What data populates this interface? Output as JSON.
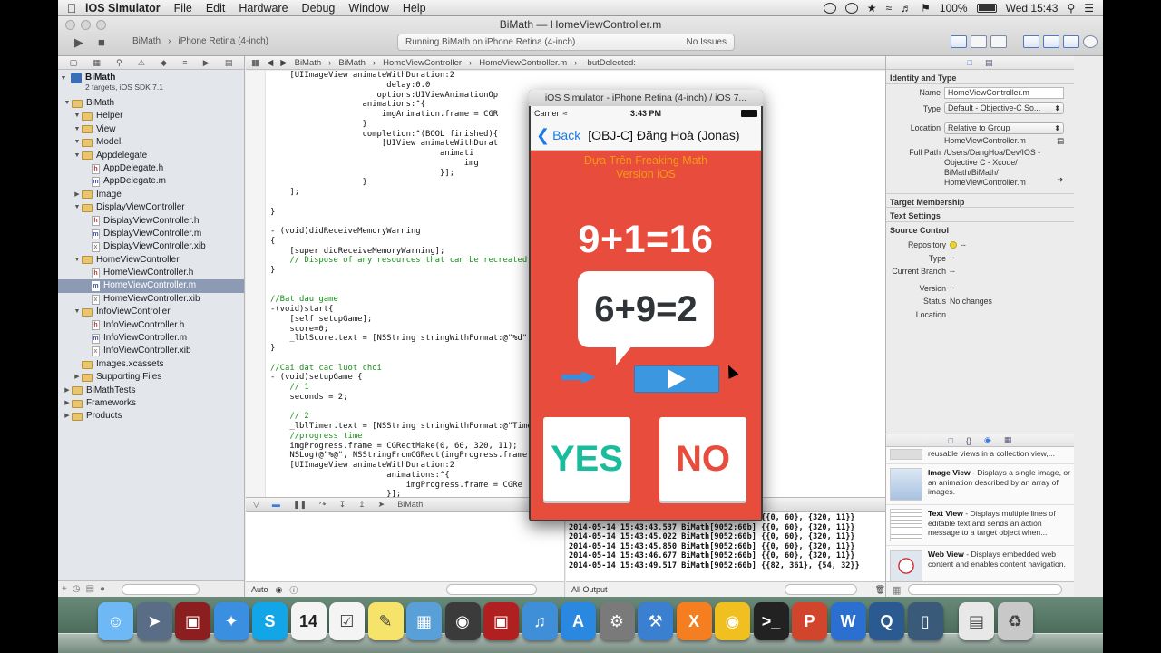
{
  "menubar": {
    "app": "iOS Simulator",
    "items": [
      "File",
      "Edit",
      "Hardware",
      "Debug",
      "Window",
      "Help"
    ],
    "battery": "100%",
    "clock": "Wed 15:43"
  },
  "xcode": {
    "window_title": "BiMath — HomeViewController.m",
    "title_project": "BiMath",
    "title_file": "HomeViewController.m",
    "scheme": "BiMath",
    "destination": "iPhone Retina (4-inch)",
    "activity": "Running BiMath on iPhone Retina (4-inch)",
    "issues": "No Issues"
  },
  "navigator": {
    "project": "BiMath",
    "project_sub": "2 targets, iOS SDK 7.1",
    "items": [
      {
        "label": "BiMath",
        "kind": "folder",
        "depth": 1,
        "open": true
      },
      {
        "label": "Helper",
        "kind": "folder",
        "depth": 2,
        "open": true
      },
      {
        "label": "View",
        "kind": "folder",
        "depth": 2,
        "open": true
      },
      {
        "label": "Model",
        "kind": "folder",
        "depth": 2,
        "open": true
      },
      {
        "label": "Appdelegate",
        "kind": "folder",
        "depth": 2,
        "open": true
      },
      {
        "label": "AppDelegate.h",
        "kind": "h",
        "depth": 3
      },
      {
        "label": "AppDelegate.m",
        "kind": "m",
        "depth": 3
      },
      {
        "label": "Image",
        "kind": "folder",
        "depth": 2,
        "open": false
      },
      {
        "label": "DisplayViewController",
        "kind": "folder",
        "depth": 2,
        "open": true
      },
      {
        "label": "DisplayViewController.h",
        "kind": "h",
        "depth": 3
      },
      {
        "label": "DisplayViewController.m",
        "kind": "m",
        "depth": 3
      },
      {
        "label": "DisplayViewController.xib",
        "kind": "x",
        "depth": 3
      },
      {
        "label": "HomeViewController",
        "kind": "folder",
        "depth": 2,
        "open": true
      },
      {
        "label": "HomeViewController.h",
        "kind": "h",
        "depth": 3
      },
      {
        "label": "HomeViewController.m",
        "kind": "m",
        "depth": 3,
        "selected": true
      },
      {
        "label": "HomeViewController.xib",
        "kind": "x",
        "depth": 3
      },
      {
        "label": "InfoViewController",
        "kind": "folder",
        "depth": 2,
        "open": true
      },
      {
        "label": "InfoViewController.h",
        "kind": "h",
        "depth": 3
      },
      {
        "label": "InfoViewController.m",
        "kind": "m",
        "depth": 3
      },
      {
        "label": "InfoViewController.xib",
        "kind": "x",
        "depth": 3
      },
      {
        "label": "Images.xcassets",
        "kind": "folder",
        "depth": 2,
        "open": null
      },
      {
        "label": "Supporting Files",
        "kind": "folder",
        "depth": 2,
        "open": false
      },
      {
        "label": "BiMathTests",
        "kind": "folder",
        "depth": 1,
        "open": false
      },
      {
        "label": "Frameworks",
        "kind": "folder",
        "depth": 1,
        "open": false
      },
      {
        "label": "Products",
        "kind": "folder",
        "depth": 1,
        "open": false
      }
    ]
  },
  "jumpbar": {
    "crumbs": [
      "BiMath",
      "BiMath",
      "HomeViewController",
      "HomeViewController.m",
      "-butDelected:"
    ]
  },
  "code_lines": [
    "    [UIImageView animateWithDuration:2",
    "                        delay:0.0",
    "                      options:UIViewAnimationOp",
    "                   animations:^{",
    "                       imgAnimation.frame = CGR",
    "                   }",
    "                   completion:^(BOOL finished){",
    "                       [UIView animateWithDurat",
    "                                   animati",
    "                                        img",
    "                                   }];",
    "                   }",
    "    ];",
    "",
    "}",
    "",
    "- (void)didReceiveMemoryWarning",
    "{",
    "    [super didReceiveMemoryWarning];",
    "    // Dispose of any resources that can be recreated.",
    "}",
    "",
    "",
    "//Bat dau game",
    "-(void)start{",
    "    [self setupGame];",
    "    score=0;",
    "    _lblScore.text = [NSString stringWithFormat:@\"%d\",",
    "}",
    "",
    "//Cai dat cac luot choi",
    "- (void)setupGame {",
    "    // 1",
    "    seconds = 2;",
    "",
    "    // 2",
    "    _lblTimer.text = [NSString stringWithFormat:@\"Time",
    "    //progress time",
    "    imgProgress.frame = CGRectMake(0, 60, 320, 11);",
    "    NSLog(@\"%@\", NSStringFromCGRect(imgProgress.frame)",
    "    [UIImageView animateWithDuration:2",
    "                        animations:^{",
    "                            imgProgress.frame = CGRe",
    "                        }];"
  ],
  "debugbar": {
    "target": "BiMath"
  },
  "varpane": {
    "scope": "Auto"
  },
  "console": {
    "lines": [
      "2014-05-14 15:43:41.519 BiMath[9052:60b] {{0, 60}, {320, 11}}",
      "2014-05-14 15:43:43.537 BiMath[9052:60b] {{0, 60}, {320, 11}}",
      "2014-05-14 15:43:45.022 BiMath[9052:60b] {{0, 60}, {320, 11}}",
      "2014-05-14 15:43:45.850 BiMath[9052:60b] {{0, 60}, {320, 11}}",
      "2014-05-14 15:43:46.677 BiMath[9052:60b] {{0, 60}, {320, 11}}",
      "2014-05-14 15:43:49.517 BiMath[9052:60b] {{82, 361}, {54, 32}}"
    ],
    "filter": "All Output"
  },
  "inspector": {
    "section_identity": "Identity and Type",
    "name_label": "Name",
    "name_value": "HomeViewController.m",
    "type_label": "Type",
    "type_value": "Default - Objective-C So...",
    "location_label": "Location",
    "location_value": "Relative to Group",
    "location_file": "HomeViewController.m",
    "fullpath_label": "Full Path",
    "fullpath_lines": [
      "/Users/DangHoa/Dev/IOS -",
      "Objective C - Xcode/",
      "BiMath/BiMath/",
      "HomeViewController.m"
    ],
    "section_target": "Target Membership",
    "section_text": "Text Settings",
    "section_source": "Source Control",
    "repo_label": "Repository",
    "repo_value": "--",
    "sc_type_label": "Type",
    "sc_type_value": "--",
    "branch_label": "Current Branch",
    "branch_value": "--",
    "version_label": "Version",
    "version_value": "--",
    "status_label": "Status",
    "status_value": "No changes",
    "loc2_label": "Location",
    "library": [
      {
        "title": "",
        "desc": "reusable views in a collection view,..."
      },
      {
        "title": "Image View",
        "desc": " - Displays a single image, or an animation described by an array of images."
      },
      {
        "title": "Text View",
        "desc": " - Displays multiple lines of editable text and sends an action message to a target object when..."
      },
      {
        "title": "Web View",
        "desc": " - Displays embedded web content and enables content navigation."
      }
    ]
  },
  "simulator": {
    "window_title": "iOS Simulator - iPhone Retina (4-inch) / iOS 7...",
    "carrier": "Carrier",
    "time": "3:43 PM",
    "back": "Back",
    "nav_title": "[OBJ-C] Đăng Hoà (Jonas)",
    "subtitle_1": "Dựa Trên Freaking Math",
    "subtitle_2": "Version iOS",
    "equation_main": "9+1=16",
    "equation_bubble": "6+9=2",
    "yes": "YES",
    "no": "NO"
  },
  "dock": {
    "icons": [
      "finder-icon",
      "launchpad-icon",
      "photo-booth-icon",
      "safari-icon",
      "skype-icon",
      "calendar-icon",
      "reminders-icon",
      "stickies-icon",
      "preview-icon",
      "facetime-icon",
      "photo-icon",
      "itunes-icon",
      "app-store-icon",
      "system-preferences-icon",
      "xcode-icon",
      "xampp-icon",
      "chrome-icon",
      "terminal-icon",
      "powerpoint-icon",
      "word-icon",
      "quicktime-icon",
      "simulator-icon",
      "documents-icon",
      "trash-icon"
    ],
    "calendar_day": "14"
  },
  "colors": {
    "app_red": "#e74c3c",
    "app_orange": "#f39c12",
    "yes_green": "#1abc9c",
    "button_blue": "#3a97e0",
    "ios_link_blue": "#1a7ae6",
    "selection": "#8c9bb3"
  }
}
